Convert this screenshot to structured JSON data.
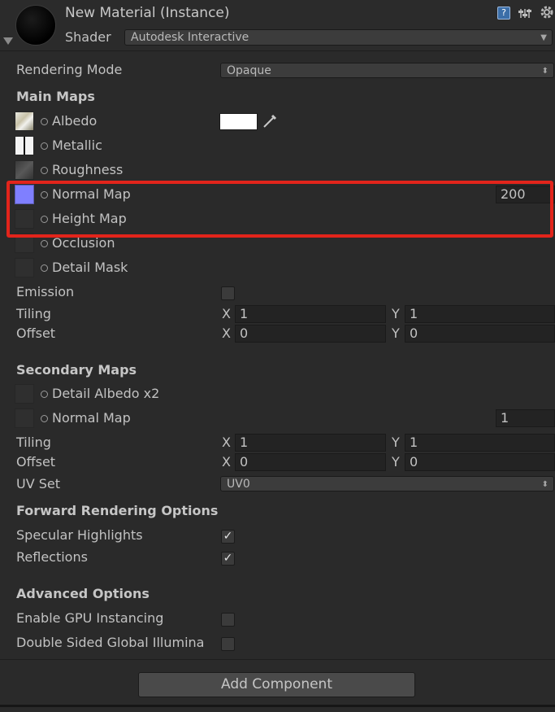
{
  "header": {
    "title": "New Material (Instance)",
    "shader_label": "Shader",
    "shader_value": "Autodesk Interactive",
    "icons": [
      "help-icon",
      "preset-icon",
      "settings-gear-icon"
    ]
  },
  "rendering_mode": {
    "label": "Rendering Mode",
    "value": "Opaque"
  },
  "main_maps": {
    "title": "Main Maps",
    "albedo": "Albedo",
    "albedo_color": "#ffffff",
    "metallic": "Metallic",
    "roughness": "Roughness",
    "normal_map": "Normal Map",
    "normal_value": "200",
    "normal_color": "#7f7fff",
    "height_map": "Height Map",
    "occlusion": "Occlusion",
    "detail_mask": "Detail Mask",
    "emission": "Emission",
    "tiling": "Tiling",
    "tiling_x": "1",
    "tiling_y": "1",
    "offset": "Offset",
    "offset_x": "0",
    "offset_y": "0",
    "x": "X",
    "y": "Y"
  },
  "secondary_maps": {
    "title": "Secondary Maps",
    "detail_albedo": "Detail Albedo x2",
    "normal_map": "Normal Map",
    "normal_value": "1",
    "tiling": "Tiling",
    "tiling_x": "1",
    "tiling_y": "1",
    "offset": "Offset",
    "offset_x": "0",
    "offset_y": "0",
    "x": "X",
    "y": "Y",
    "uv_set_label": "UV Set",
    "uv_set_value": "UV0"
  },
  "forward_rendering": {
    "title": "Forward Rendering Options",
    "specular": "Specular Highlights",
    "specular_checked": "✓",
    "reflections": "Reflections",
    "reflections_checked": "✓"
  },
  "advanced": {
    "title": "Advanced Options",
    "gpu_instancing": "Enable GPU Instancing",
    "double_sided": "Double Sided Global Illumina"
  },
  "add_component": "Add Component",
  "colors": {
    "highlight": "#e2241b",
    "background": "#2a2a2a"
  }
}
